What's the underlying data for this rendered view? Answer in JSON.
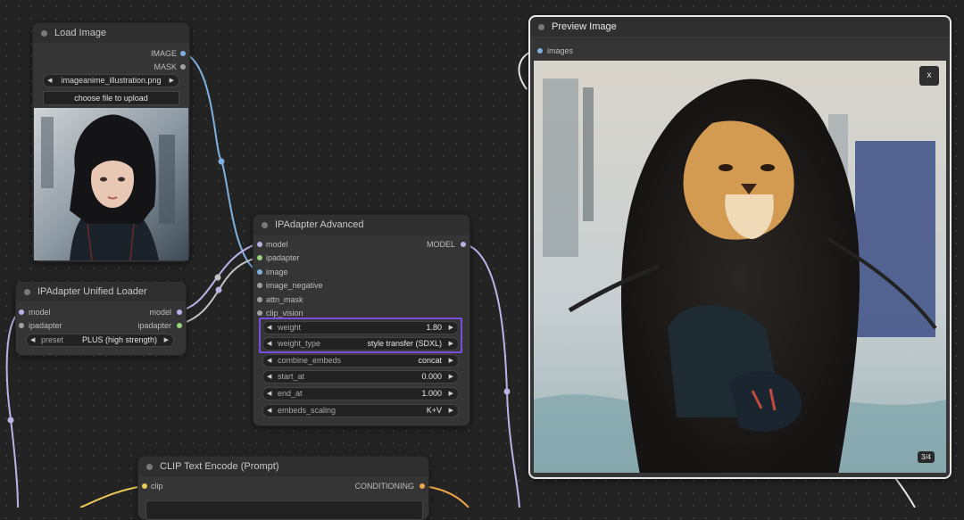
{
  "load_image": {
    "title": "Load Image",
    "outputs": [
      "IMAGE",
      "MASK"
    ],
    "image_widget": "imageanime_illustration.png",
    "upload_button": "choose file to upload"
  },
  "unified_loader": {
    "title": "IPAdapter Unified Loader",
    "inputs": [
      "model",
      "ipadapter"
    ],
    "outputs": [
      "model",
      "ipadapter"
    ],
    "preset_label": "preset",
    "preset_value": "PLUS (high strength)"
  },
  "ipadapter_advanced": {
    "title": "IPAdapter Advanced",
    "inputs": [
      "model",
      "ipadapter",
      "image",
      "image_negative",
      "attn_mask",
      "clip_vision"
    ],
    "output": "MODEL",
    "widgets": [
      {
        "label": "weight",
        "value": "1.80"
      },
      {
        "label": "weight_type",
        "value": "style transfer (SDXL)"
      },
      {
        "label": "combine_embeds",
        "value": "concat"
      },
      {
        "label": "start_at",
        "value": "0.000"
      },
      {
        "label": "end_at",
        "value": "1.000"
      },
      {
        "label": "embeds_scaling",
        "value": "K+V"
      }
    ]
  },
  "preview": {
    "title": "Preview Image",
    "input": "images",
    "close": "x",
    "counter": "3/4"
  },
  "clip_encode": {
    "title": "CLIP Text Encode (Prompt)",
    "input": "clip",
    "output": "CONDITIONING"
  },
  "colors": {
    "highlight": "#7a4fe0",
    "wire_model": "#b9b3e6",
    "wire_image": "#7fb0e0",
    "wire_conditioning": "#f0a64a",
    "wire_clip": "#e8c95a"
  }
}
